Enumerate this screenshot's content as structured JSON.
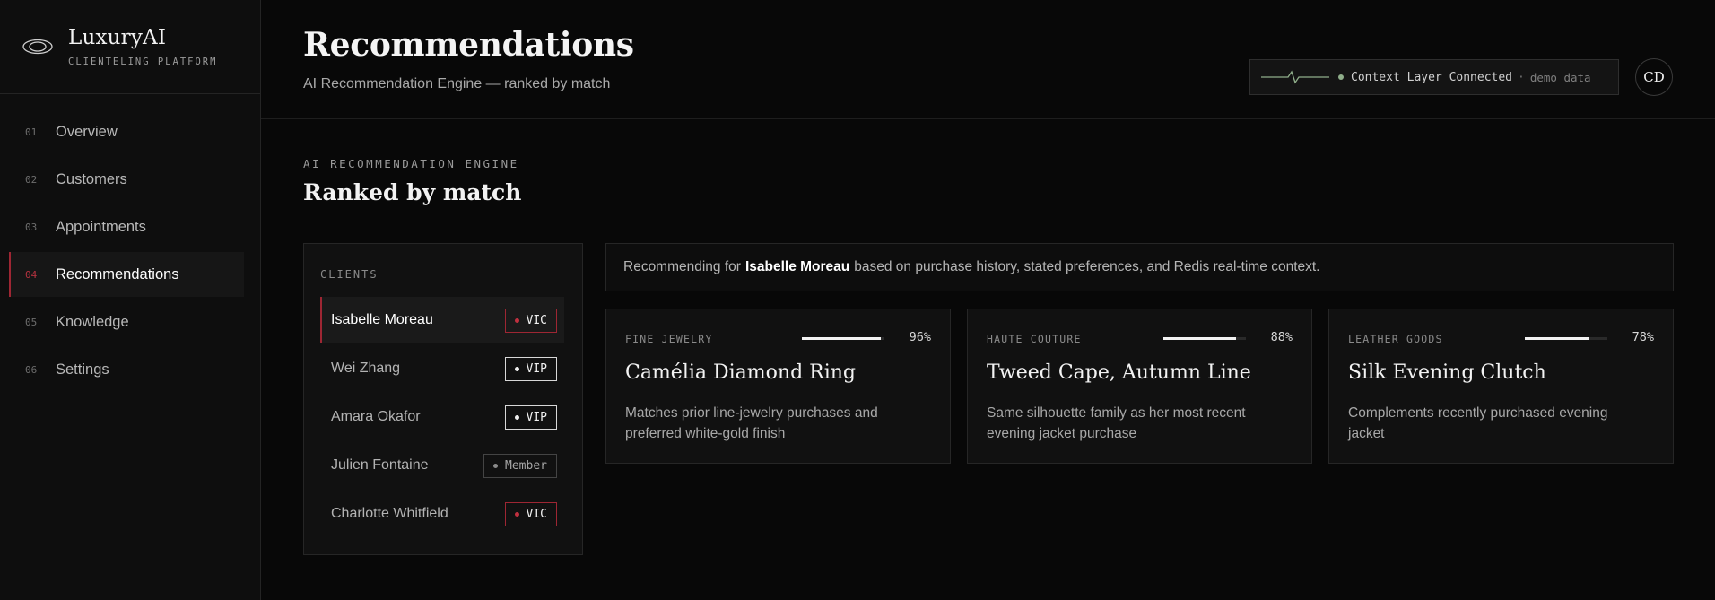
{
  "brand": {
    "name": "LuxuryAI",
    "subtitle": "CLIENTELING PLATFORM"
  },
  "nav": {
    "items": [
      {
        "num": "01",
        "label": "Overview"
      },
      {
        "num": "02",
        "label": "Customers"
      },
      {
        "num": "03",
        "label": "Appointments"
      },
      {
        "num": "04",
        "label": "Recommendations"
      },
      {
        "num": "05",
        "label": "Knowledge"
      },
      {
        "num": "06",
        "label": "Settings"
      }
    ],
    "active_index": 3
  },
  "header": {
    "title": "Recommendations",
    "subtitle": "AI Recommendation Engine — ranked by match",
    "status": {
      "label": "Context Layer Connected",
      "separator": "·",
      "note": "demo data",
      "color": "#8fae8a"
    },
    "avatar_initials": "CD"
  },
  "section": {
    "eyebrow": "AI RECOMMENDATION ENGINE",
    "title": "Ranked by match"
  },
  "clients": {
    "eyebrow": "CLIENTS",
    "items": [
      {
        "name": "Isabelle Moreau",
        "tier": "VIC",
        "active": true
      },
      {
        "name": "Wei Zhang",
        "tier": "VIP"
      },
      {
        "name": "Amara Okafor",
        "tier": "VIP"
      },
      {
        "name": "Julien Fontaine",
        "tier": "Member"
      },
      {
        "name": "Charlotte Whitfield",
        "tier": "VIC"
      }
    ]
  },
  "context": {
    "prefix": "Recommending for",
    "client": "Isabelle Moreau",
    "suffix": "based on purchase history, stated preferences, and Redis real-time context."
  },
  "recommendations": [
    {
      "category": "FINE JEWELRY",
      "match": 96,
      "match_label": "96%",
      "title": "Camélia Diamond Ring",
      "description": "Matches prior line-jewelry purchases and preferred white-gold finish"
    },
    {
      "category": "HAUTE COUTURE",
      "match": 88,
      "match_label": "88%",
      "title": "Tweed Cape, Autumn Line",
      "description": "Same silhouette family as her most recent evening jacket purchase"
    },
    {
      "category": "LEATHER GOODS",
      "match": 78,
      "match_label": "78%",
      "title": "Silk Evening Clutch",
      "description": "Complements recently purchased evening jacket"
    }
  ],
  "colors": {
    "accent": "#9e2633",
    "background": "#080808",
    "panel": "#111111"
  }
}
